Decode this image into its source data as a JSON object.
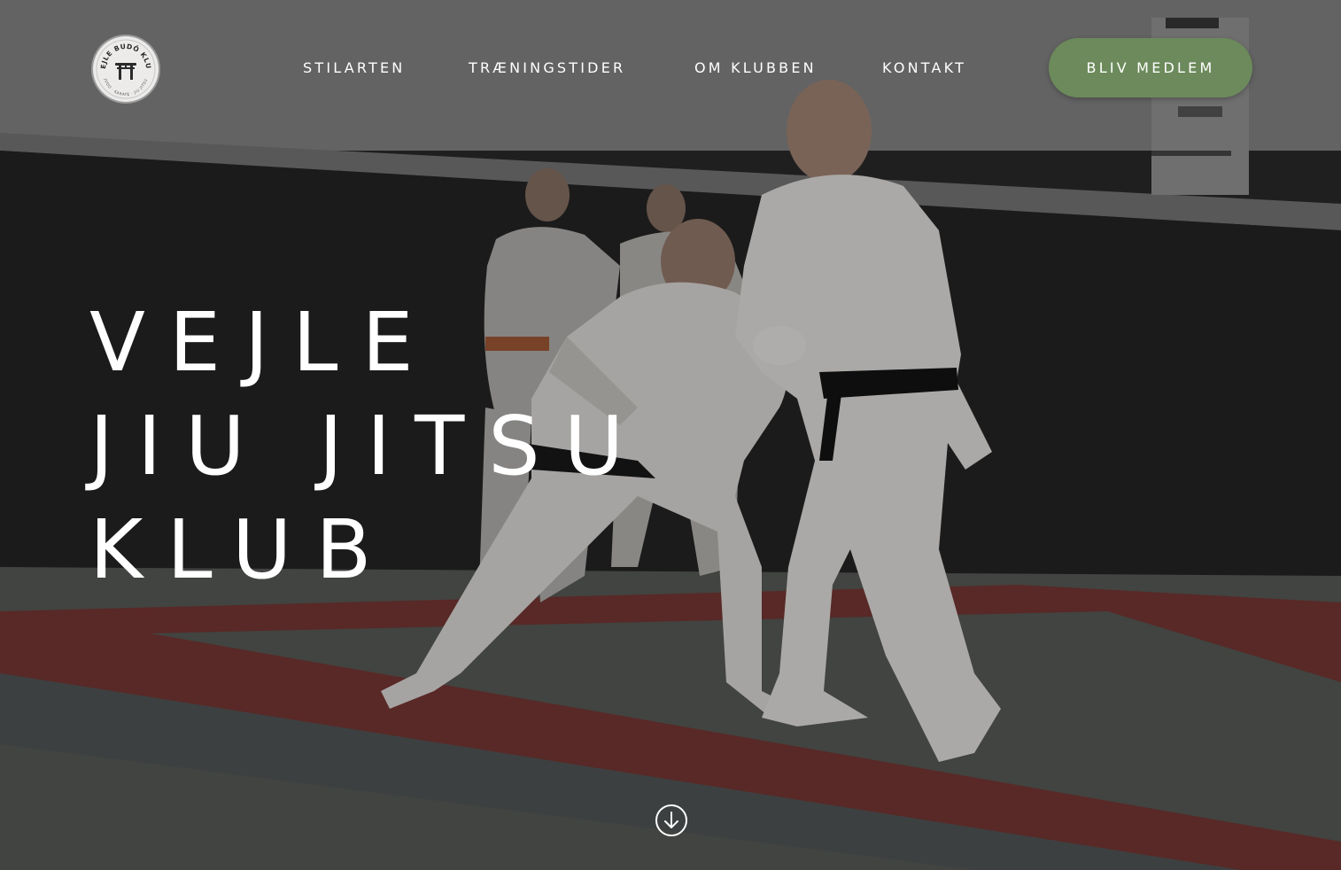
{
  "logo": {
    "text_top": "VEJLE BUDŌ KLUB",
    "text_bottom": "JUDO · KARATE · JIU JITSU",
    "icon": "torii-gate-icon"
  },
  "nav": {
    "items": [
      {
        "label": "STILARTEN"
      },
      {
        "label": "TRÆNINGSTIDER"
      },
      {
        "label": "OM KLUBBEN"
      },
      {
        "label": "KONTAKT"
      }
    ],
    "cta_label": "BLIV MEDLEM"
  },
  "hero": {
    "title_lines": [
      "VEJLE",
      "JIU JITSU",
      "KLUB"
    ],
    "scroll_icon": "arrow-down-circle-icon"
  },
  "colors": {
    "accent": "#6c8a5b",
    "text": "#ffffff"
  }
}
